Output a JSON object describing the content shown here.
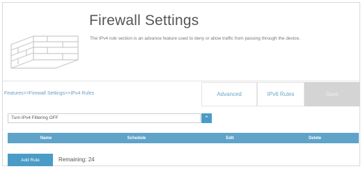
{
  "header": {
    "title": "Firewall Settings",
    "description": "The IPv4 rule section is an advance feature used to deny or allow traffic from passing through the device."
  },
  "breadcrumb": "Features>>Firewall Settings>>IPv4 Rules",
  "buttons": {
    "advanced": "Advanced",
    "ipv6_rules": "IPv6 Rules",
    "save": "Save"
  },
  "filter": {
    "selected": "Turn IPv4 Filtering OFF"
  },
  "table": {
    "columns": [
      "Name",
      "Schedule",
      "Edit",
      "Delete"
    ]
  },
  "footer": {
    "add_rule": "Add Rule",
    "remaining": "Remaining: 24"
  },
  "colors": {
    "accent": "#4a9cc7",
    "table_header": "#5fa3c9",
    "save_disabled": "#d4d4d4"
  }
}
